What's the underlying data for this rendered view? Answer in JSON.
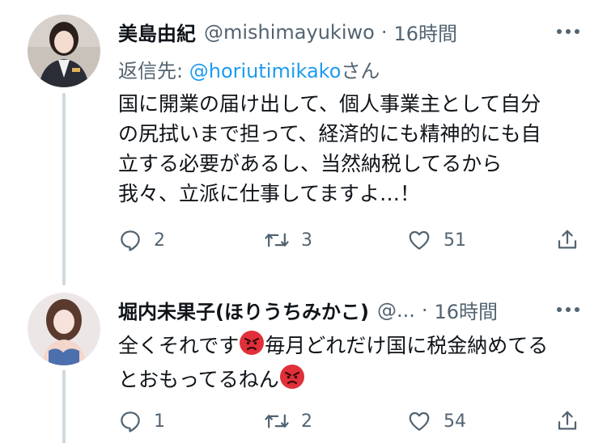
{
  "tweets": [
    {
      "author_name": "美島由紀",
      "author_handle": "@mishimayukiwo",
      "separator": "·",
      "time": "16時間",
      "reply_prefix": "返信先:",
      "reply_handle": "@horiutimikako",
      "reply_suffix": "さん",
      "lines": [
        "国に開業の届け出して、個人事業主として自分",
        "の尻拭いまで担って、経済的にも精神的にも自",
        "立する必要があるし、当然納税してるから",
        "我々、立派に仕事してますよ…！"
      ],
      "replies": "2",
      "retweets": "3",
      "likes": "51"
    },
    {
      "author_name": "堀内未果子(ほりうちみかこ)",
      "author_handle": "@...",
      "separator": "·",
      "time": "16時間",
      "line1_a": "全くそれです",
      "line1_b": "毎月どれだけ国に税金納めてる",
      "line2_a": "とおもってるねん",
      "emoji": "angry-face",
      "replies": "1",
      "retweets": "2",
      "likes": "54"
    }
  ],
  "colors": {
    "text": "#0f1419",
    "secondary": "#536471",
    "link": "#1d9bf0",
    "thread_line": "#cfd9de",
    "emoji_red": "#e0303a"
  }
}
